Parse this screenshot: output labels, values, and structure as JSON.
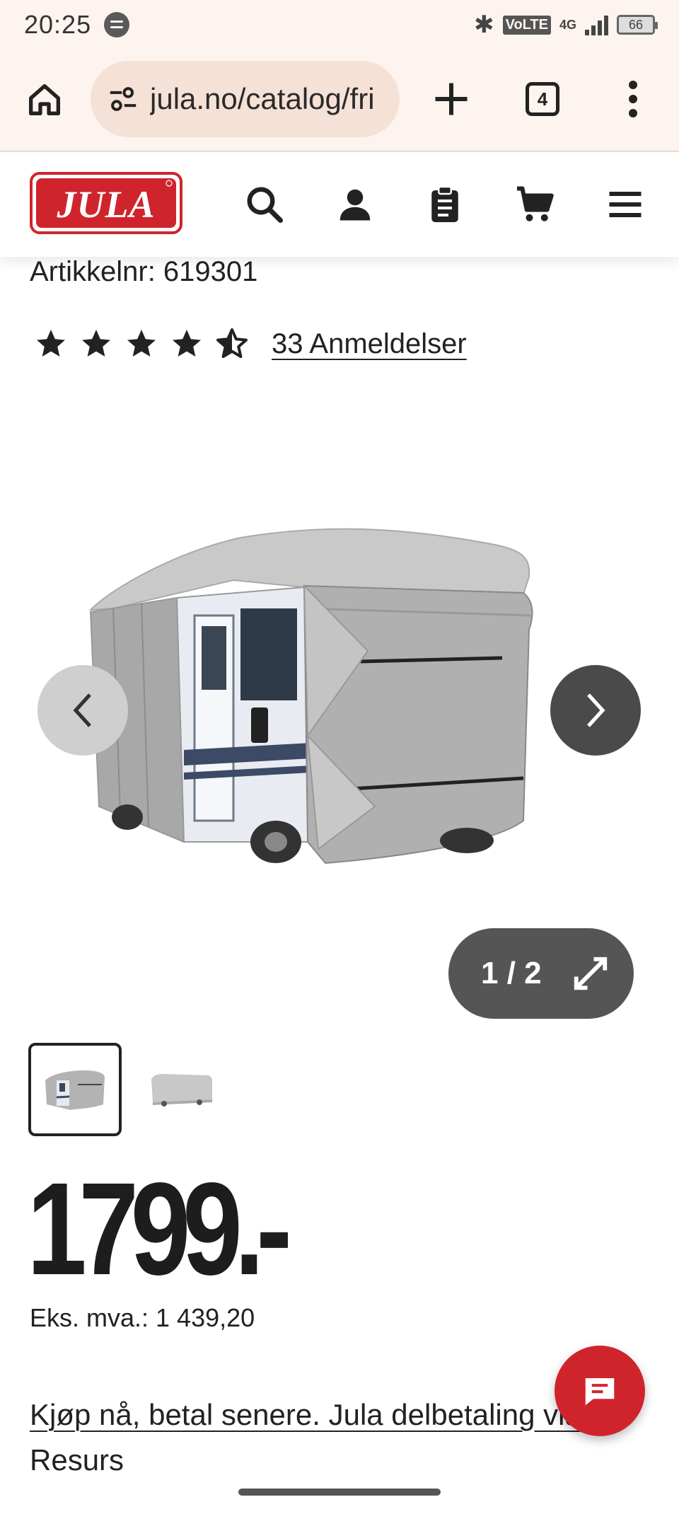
{
  "status_bar": {
    "time": "20:25",
    "volte": "VoLTE",
    "network": "4G",
    "battery": "66"
  },
  "browser": {
    "url": "jula.no/catalog/fri",
    "tab_count": "4"
  },
  "site": {
    "logo_text": "JULA",
    "brand_color": "#d0242d"
  },
  "product": {
    "article_number": "Artikkelnr: 619301",
    "rating": 4.5,
    "rating_max": 5,
    "reviews_label": "33 Anmeldelser",
    "gallery_counter": "1 / 2",
    "price": "1799.-",
    "ex_vat": "Eks. mva.: 1 439,20",
    "pay_later_link": "Kjøp nå, betal senere. Jula delbetaling via",
    "pay_later_rest": "Resurs"
  },
  "icons": {
    "home": "home-icon",
    "site_settings": "tune-icon",
    "new_tab": "plus-icon",
    "browser_menu": "more-vert-icon",
    "search": "search-icon",
    "account": "person-icon",
    "list": "clipboard-icon",
    "cart": "cart-icon",
    "menu": "hamburger-icon",
    "prev": "chevron-left-icon",
    "next": "chevron-right-icon",
    "expand": "expand-icon",
    "chat": "chat-icon"
  }
}
